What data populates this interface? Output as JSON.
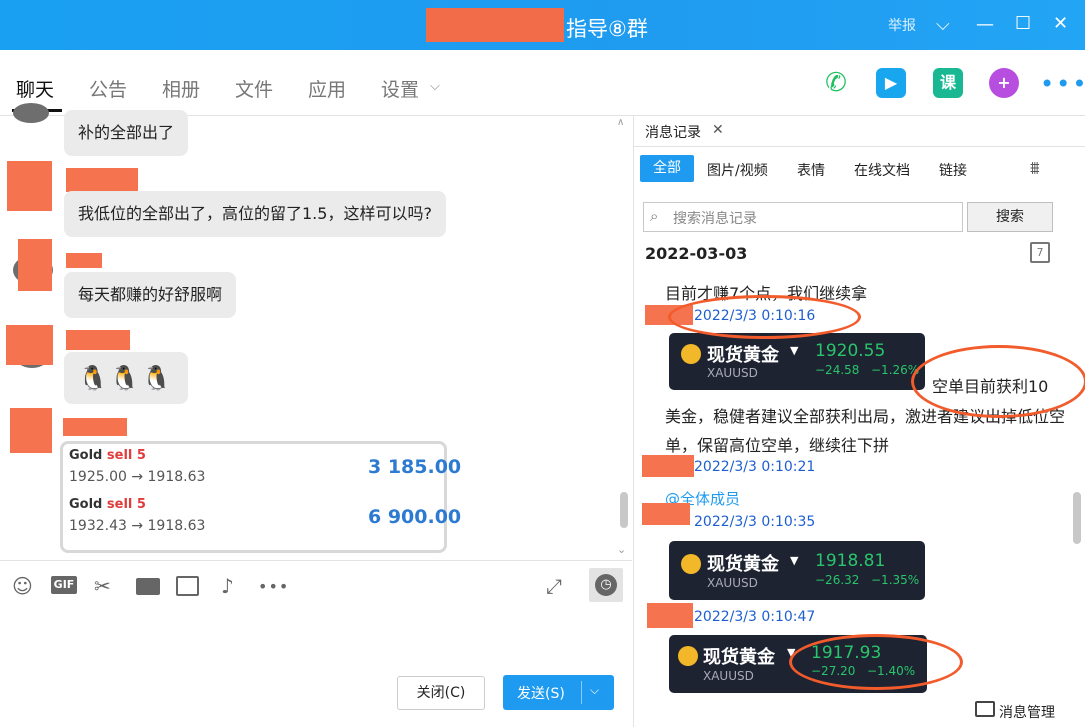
{
  "window": {
    "title": "指导⑧群",
    "report": "举报",
    "controls": [
      "⌵",
      "—",
      "☐",
      "✕"
    ]
  },
  "nav": {
    "tabs": [
      "聊天",
      "公告",
      "相册",
      "文件",
      "应用",
      "设置"
    ],
    "course_icon": "课",
    "icons": [
      "phone-icon",
      "video-icon",
      "course-icon",
      "add-icon",
      "more-icon"
    ]
  },
  "chat": {
    "messages": [
      "补的全部出了",
      "我低位的全部出了，高位的留了1.5，这样可以吗?",
      "每天都赚的好舒服啊",
      "🐧🐧🐧"
    ],
    "trade_card": {
      "rows": [
        {
          "label": "Gold",
          "action": "sell 5",
          "route": "1925.00 → 1918.63",
          "value": "3 185.00"
        },
        {
          "label": "Gold",
          "action": "sell 5",
          "route": "1932.43 → 1918.63",
          "value": "6 900.00"
        }
      ]
    }
  },
  "toolbar": {
    "icons": [
      "emoji-icon",
      "gif-icon",
      "scissors-icon",
      "folder-icon",
      "image-icon",
      "bell-icon",
      "more-icon"
    ]
  },
  "compose": {
    "close_label": "关闭(C)",
    "send_label": "发送(S)"
  },
  "history": {
    "tab_label": "消息记录",
    "tabs": [
      "全部",
      "图片/视频",
      "表情",
      "在线文档",
      "链接"
    ],
    "search_placeholder": "搜索消息记录",
    "search_button": "搜索",
    "date": "2022-03-03",
    "entries": [
      {
        "text": "目前才赚7个点，我们继续拿"
      },
      {
        "time": "2022/3/3 0:10:16"
      },
      {
        "text": "空单目前获利10"
      },
      {
        "text": "美金，稳健者建议全部获利出局，激进者建议出掉低位空单，保留高位空单，继续往下拼"
      },
      {
        "time": "2022/3/3 0:10:21"
      },
      {
        "text": "@全体成员"
      },
      {
        "time": "2022/3/3 0:10:35"
      },
      {
        "time": "2022/3/3 0:10:47"
      }
    ],
    "quotes": [
      {
        "name": "现货黄金",
        "symbol": "XAUUSD",
        "price": "1920.55",
        "change": "−24.58",
        "pct": "−1.26%"
      },
      {
        "name": "现货黄金",
        "symbol": "XAUUSD",
        "price": "1918.81",
        "change": "−26.32",
        "pct": "−1.35%"
      },
      {
        "name": "现货黄金",
        "symbol": "XAUUSD",
        "price": "1917.93",
        "change": "−27.20",
        "pct": "−1.40%"
      }
    ],
    "manage_label": "消息管理"
  }
}
